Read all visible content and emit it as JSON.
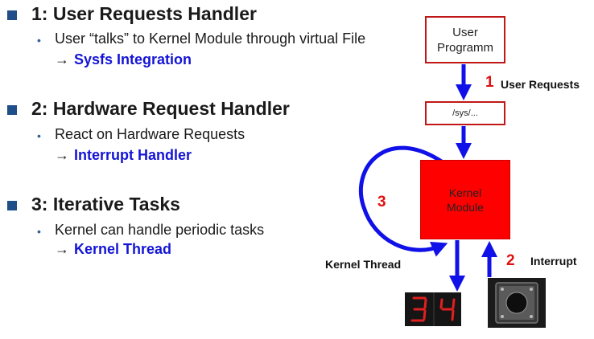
{
  "sections": [
    {
      "heading": "1: User Requests Handler",
      "description": "User “talks” to Kernel Module through virtual File",
      "arrow": "→",
      "result": "Sysfs Integration"
    },
    {
      "heading": "2: Hardware Request Handler",
      "description": "React on Hardware Requests",
      "arrow": "→",
      "result": "Interrupt Handler"
    },
    {
      "heading": "3: Iterative Tasks",
      "description": "Kernel can handle periodic tasks",
      "arrow": "→",
      "result": "Kernel Thread"
    }
  ],
  "diagram": {
    "user_box_line1": "User",
    "user_box_line2": "Programm",
    "sys_box": "/sys/...",
    "kernel_line1": "Kernel",
    "kernel_line2": "Module",
    "label_user_requests_num": "1",
    "label_user_requests": "User Requests",
    "label_interrupt_num": "2",
    "label_interrupt": "Interrupt",
    "label_loop_num": "3",
    "label_kernel_thread": "Kernel Thread",
    "seven_segment_digits": "34",
    "icons": [
      "seven-segment-display-icon",
      "push-button-icon"
    ]
  },
  "colors": {
    "bullet": "#1f4e89",
    "highlight": "#1414d6",
    "kernel_fill": "#ff0000",
    "box_border": "#c01818",
    "arrow": "#1010e8",
    "number_red": "#e01010"
  }
}
